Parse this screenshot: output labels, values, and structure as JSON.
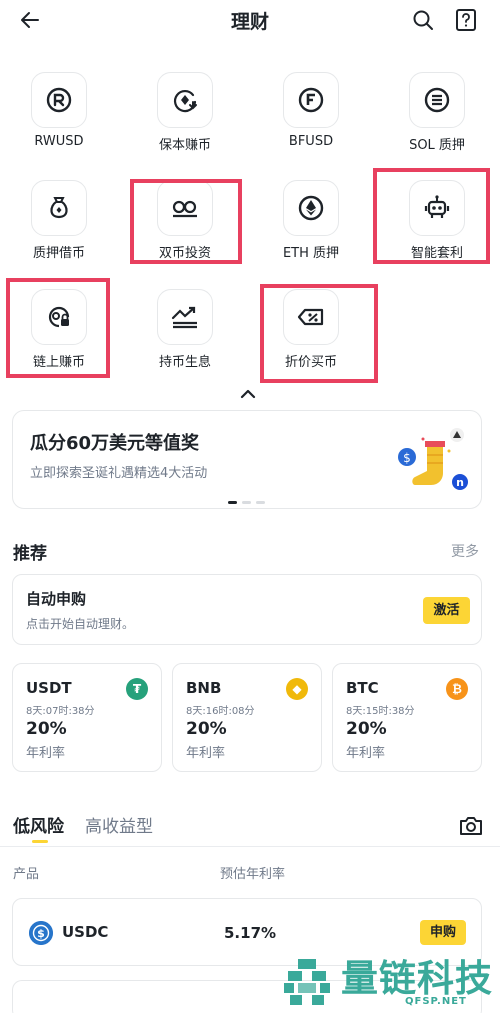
{
  "header": {
    "title": "理财"
  },
  "grid": [
    {
      "label": "RWUSD",
      "icon": "rwusd-icon"
    },
    {
      "label": "保本赚币",
      "icon": "principal-protected-icon"
    },
    {
      "label": "BFUSD",
      "icon": "bfusd-icon"
    },
    {
      "label": "SOL 质押",
      "icon": "sol-staking-icon"
    },
    {
      "label": "质押借币",
      "icon": "collateral-loan-icon"
    },
    {
      "label": "双币投资",
      "icon": "dual-investment-icon"
    },
    {
      "label": "ETH 质押",
      "icon": "eth-staking-icon"
    },
    {
      "label": "智能套利",
      "icon": "smart-arbitrage-icon"
    },
    {
      "label": "链上赚币",
      "icon": "onchain-earn-icon"
    },
    {
      "label": "持币生息",
      "icon": "hold-interest-icon"
    },
    {
      "label": "折价买币",
      "icon": "discount-buy-icon"
    }
  ],
  "banner": {
    "title": "瓜分60万美元等值奖",
    "subtitle": "立即探索圣诞礼遇精选4大活动"
  },
  "recommend": {
    "title": "推荐",
    "more": "更多",
    "auto": {
      "title": "自动申购",
      "subtitle": "点击开始自动理财。",
      "button": "激活"
    },
    "coins": [
      {
        "name": "USDT",
        "time": "8天:07时:38分",
        "rate": "20%",
        "rate_label": "年利率",
        "color": "#26a17b",
        "symbol": "₮"
      },
      {
        "name": "BNB",
        "time": "8天:16时:08分",
        "rate": "20%",
        "rate_label": "年利率",
        "color": "#f0b90b",
        "symbol": "◆"
      },
      {
        "name": "BTC",
        "time": "8天:15时:38分",
        "rate": "20%",
        "rate_label": "年利率",
        "color": "#f7931a",
        "symbol": "₿"
      }
    ]
  },
  "tabs": {
    "low_risk": "低风险",
    "high_yield": "高收益型"
  },
  "table": {
    "col_product": "产品",
    "col_apr": "预估年利率",
    "rows": [
      {
        "name": "USDC",
        "apr": "5.17%",
        "button": "申购"
      }
    ]
  },
  "watermark": {
    "text": "量链科技",
    "url": "QFSP.NET"
  }
}
